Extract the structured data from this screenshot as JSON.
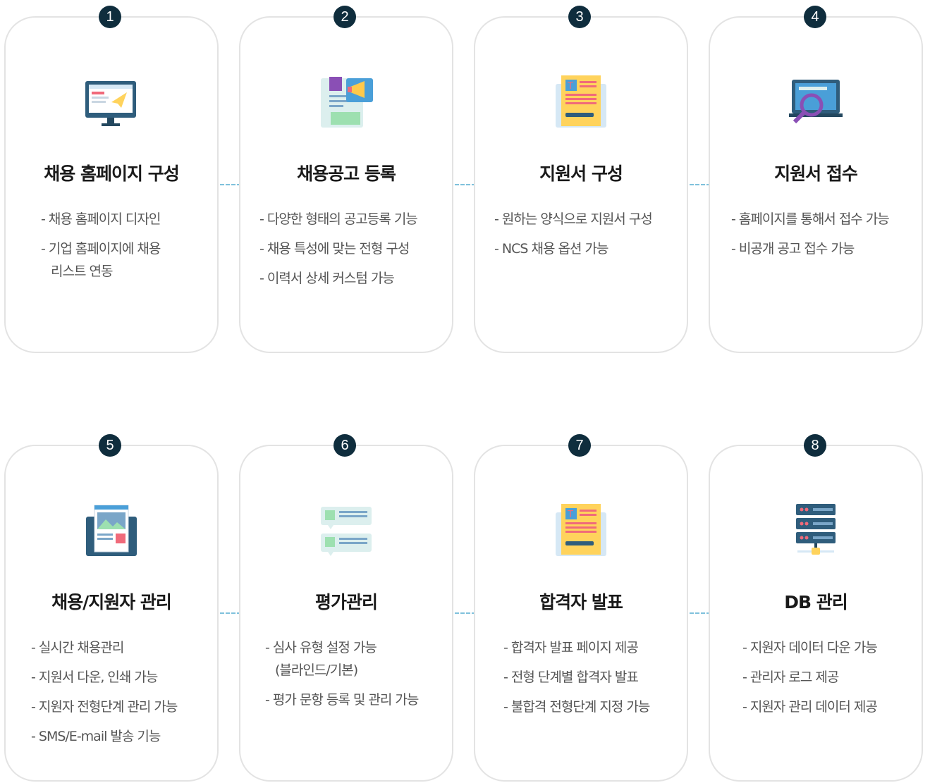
{
  "steps": [
    {
      "number": "1",
      "title": "채용 홈페이지 구성",
      "items": [
        "- 채용 홈페이지 디자인",
        "- 기업 홈페이지에 채용\n리스트 연동"
      ]
    },
    {
      "number": "2",
      "title": "채용공고 등록",
      "items": [
        "- 다양한 형태의 공고등록 기능",
        "- 채용 특성에 맞는 전형 구성",
        "- 이력서 상세 커스텀 가능"
      ]
    },
    {
      "number": "3",
      "title": "지원서 구성",
      "items": [
        "- 원하는 양식으로 지원서 구성",
        "- NCS 채용 옵션 가능"
      ]
    },
    {
      "number": "4",
      "title": "지원서 접수",
      "items": [
        "- 홈페이지를 통해서 접수 가능",
        "- 비공개 공고 접수 가능"
      ]
    },
    {
      "number": "5",
      "title": "채용/지원자 관리",
      "items": [
        "- 실시간 채용관리",
        "- 지원서 다운, 인쇄 가능",
        "- 지원자 전형단계 관리 가능",
        "- SMS/E-mail 발송 기능"
      ]
    },
    {
      "number": "6",
      "title": "평가관리",
      "items": [
        "- 심사 유형 설정 가능\n(블라인드/기본)",
        "- 평가 문항 등록 및 관리 가능"
      ]
    },
    {
      "number": "7",
      "title": "합격자 발표",
      "items": [
        "- 합격자 발표 페이지 제공",
        "- 전형 단계별 합격자 발표",
        "- 불합격 전형단계 지정 가능"
      ]
    },
    {
      "number": "8",
      "title": "DB 관리",
      "items": [
        "- 지원자 데이터 다운 가능",
        "- 관리자 로그 제공",
        "- 지원자 관리 데이터 제공"
      ]
    }
  ],
  "icons": [
    "monitor-icon",
    "newspaper-megaphone-icon",
    "application-form-icon",
    "laptop-search-icon",
    "image-document-icon",
    "chat-review-icon",
    "application-form-icon",
    "server-database-icon"
  ],
  "colors": {
    "badge": "#0f2d3d",
    "connector": "#7fc1dc",
    "card_border": "#e3e3e3"
  }
}
